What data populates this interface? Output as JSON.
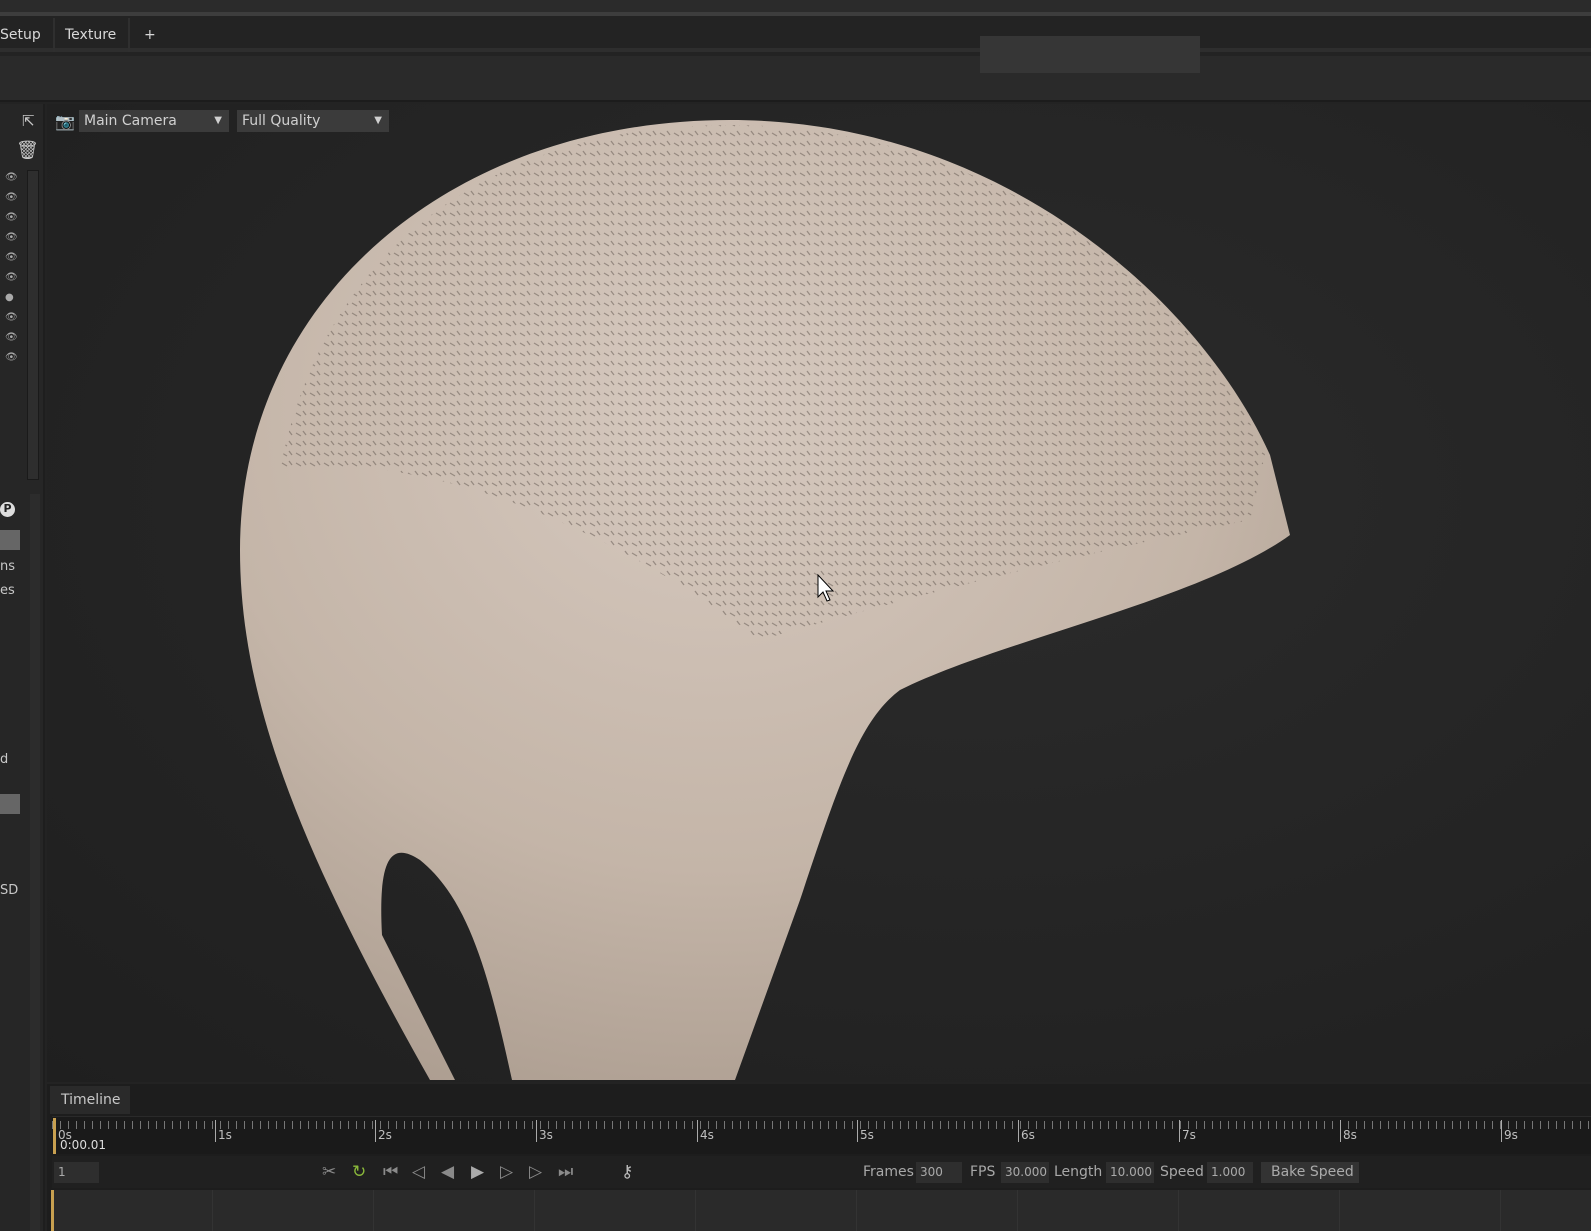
{
  "tabs": [
    {
      "label": "Setup"
    },
    {
      "label": "Texture"
    },
    {
      "label": "+"
    }
  ],
  "viewport": {
    "camera": "Main Camera",
    "quality": "Full Quality"
  },
  "left_panel": {
    "partial_labels": [
      "ns",
      "es",
      "d",
      "SD"
    ]
  },
  "timeline": {
    "tab_label": "Timeline",
    "ticks": [
      "0s",
      "1s",
      "2s",
      "3s",
      "4s",
      "5s",
      "6s",
      "7s",
      "8s",
      "9s"
    ],
    "current_time": "0:00.01",
    "frame_input": "1",
    "frames_label": "Frames",
    "frames": "300",
    "fps_label": "FPS",
    "fps": "30.000",
    "length_label": "Length",
    "length": "10.000",
    "speed_label": "Speed",
    "speed": "1.000",
    "bake_speed": "Bake Speed"
  },
  "colors": {
    "loop_active": "#8ab83a",
    "playhead": "#c8a050",
    "model": "#cdbfb3"
  }
}
